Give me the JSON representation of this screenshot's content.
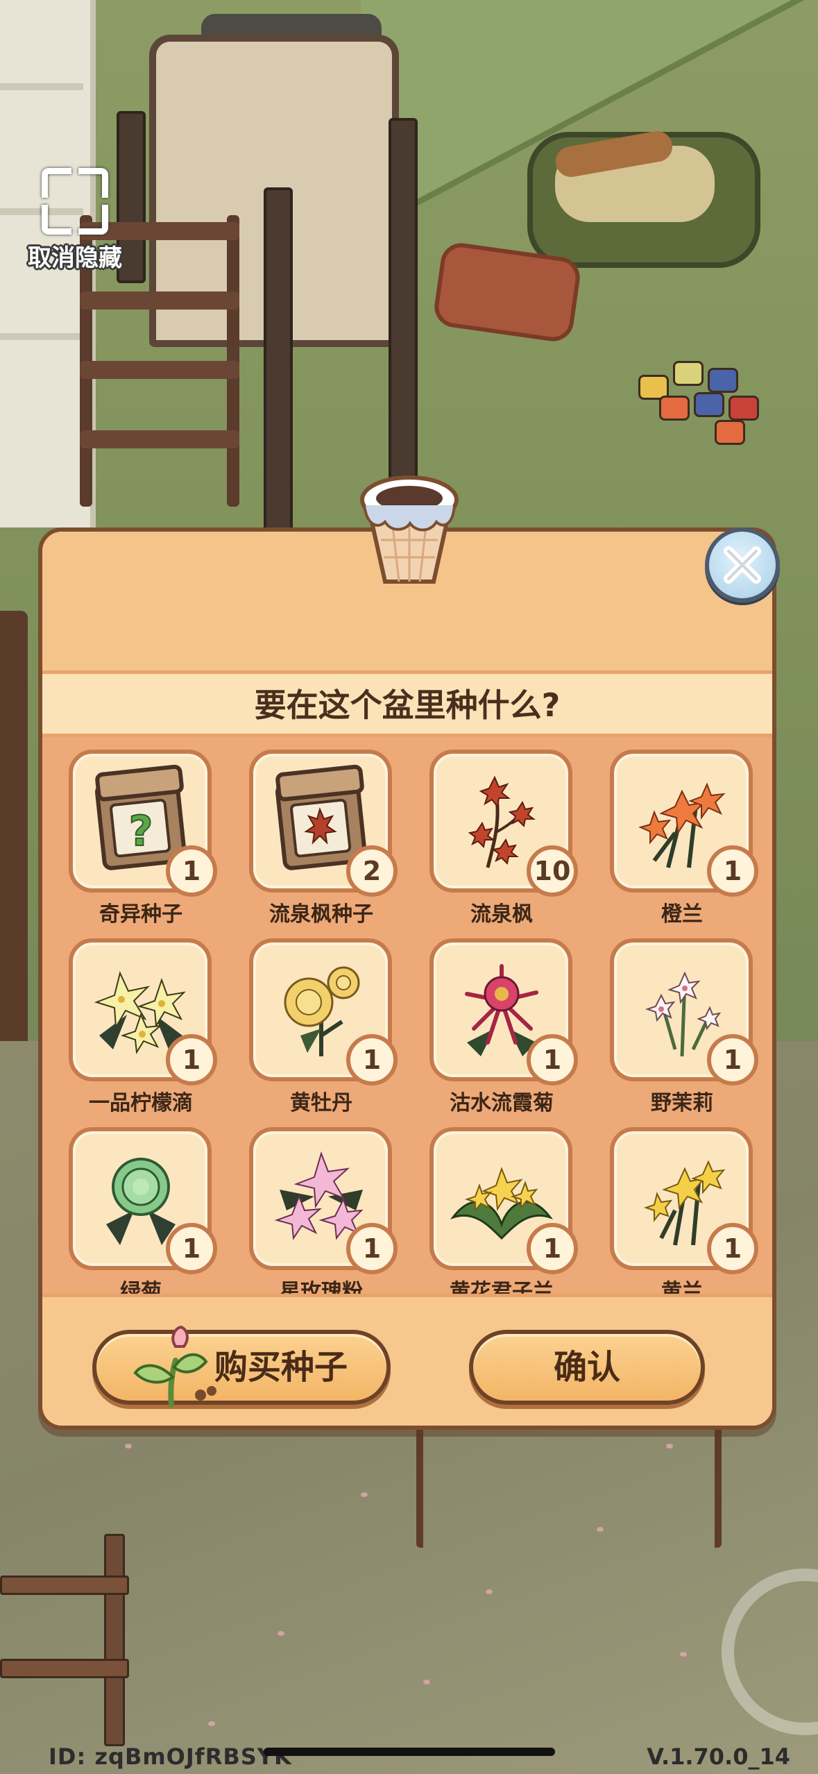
{
  "hide_toggle": {
    "label": "取消隐藏",
    "icon": "fullscreen-bracket-icon"
  },
  "dialog": {
    "title": "要在这个盆里种什么?",
    "items": [
      {
        "name": "奇异种子",
        "count": "1",
        "icon": "mystery-seed-packet-icon"
      },
      {
        "name": "流泉枫种子",
        "count": "2",
        "icon": "maple-seed-packet-icon"
      },
      {
        "name": "流泉枫",
        "count": "10",
        "icon": "red-maple-icon"
      },
      {
        "name": "橙兰",
        "count": "1",
        "icon": "orange-orchid-icon"
      },
      {
        "name": "一品柠檬滴",
        "count": "1",
        "icon": "lemon-drop-flower-icon"
      },
      {
        "name": "黄牡丹",
        "count": "1",
        "icon": "yellow-peony-icon"
      },
      {
        "name": "沽水流霞菊",
        "count": "1",
        "icon": "pink-chrysanthemum-icon"
      },
      {
        "name": "野茉莉",
        "count": "1",
        "icon": "wild-jasmine-icon"
      },
      {
        "name": "绿菊",
        "count": "1",
        "icon": "green-chrysanthemum-icon"
      },
      {
        "name": "星玫瑰粉",
        "count": "1",
        "icon": "pink-star-lily-icon"
      },
      {
        "name": "黄花君子兰",
        "count": "1",
        "icon": "yellow-clivia-icon"
      },
      {
        "name": "黄兰",
        "count": "1",
        "icon": "yellow-orchid-icon"
      }
    ],
    "buy_button": "购买种子",
    "confirm_button": "确认"
  },
  "footer": {
    "id": "ID: zqBmOJfRBSYK",
    "version": "V.1.70.0_14"
  },
  "colors": {
    "panel": "#f6c88e",
    "tile": "#fbe6c0",
    "tile_border": "#c67b4c",
    "text": "#4a2f1f"
  }
}
